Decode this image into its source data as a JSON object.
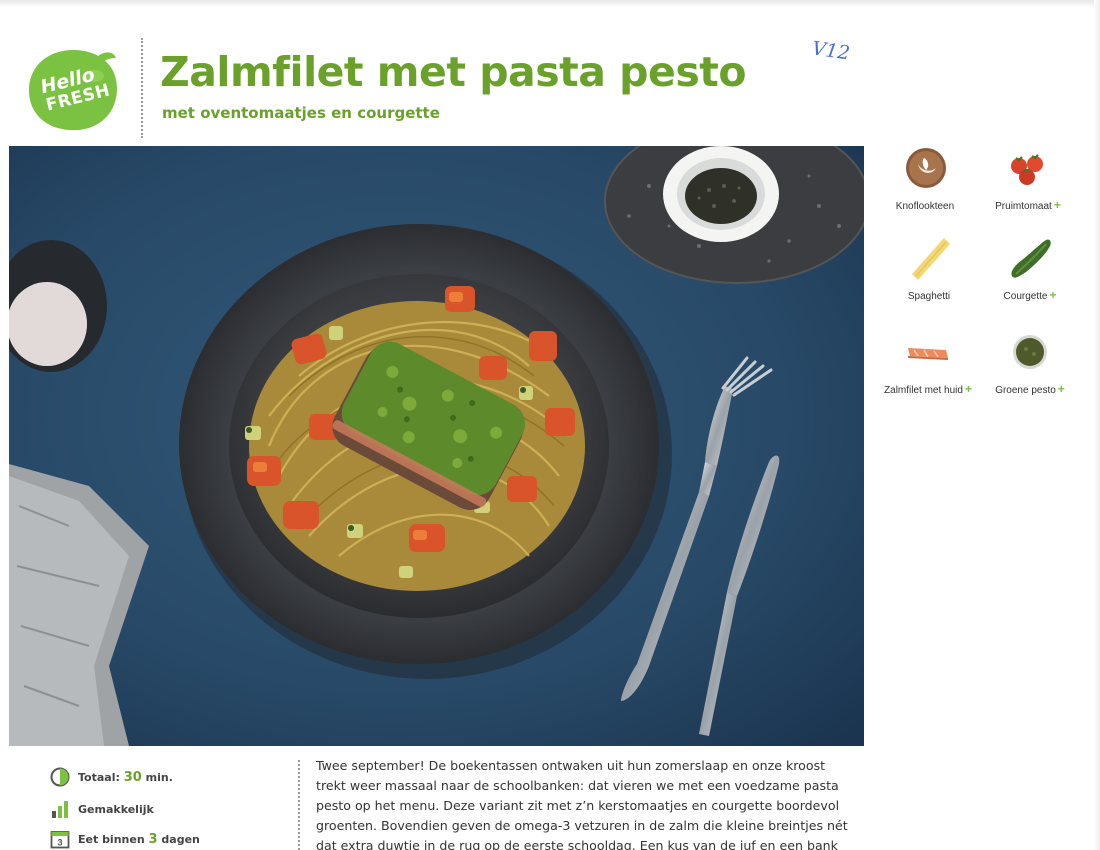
{
  "header": {
    "logo_line1": "Hello",
    "logo_line2": "FRESH",
    "title": "Zalmfilet met pasta pesto",
    "subtitle": "met oventomaatjes en courgette",
    "handwritten_note": "V12"
  },
  "ingredients": [
    {
      "name": "Knoflookteen",
      "plus": ""
    },
    {
      "name": "Pruimtomaat",
      "plus": "+"
    },
    {
      "name": "Spaghetti",
      "plus": ""
    },
    {
      "name": "Courgette",
      "plus": "+"
    },
    {
      "name": "Zalmfilet met huid",
      "plus": "+"
    },
    {
      "name": "Groene pesto",
      "plus": "+"
    }
  ],
  "meta": {
    "total_label": "Totaal:",
    "total_value": "30",
    "total_unit": "min.",
    "difficulty": "Gemakkelijk",
    "eat_within_prefix": "Eet binnen",
    "eat_within_value": "3",
    "eat_within_suffix": "dagen",
    "calendar_number": "3"
  },
  "intro_text": "Twee september! De boekentassen ontwaken uit hun zomerslaap en onze kroost trekt weer massaal naar de schoolbanken: dat vieren we met een voedzame pasta pesto op het menu. Deze variant zit met z’n kerstomaatjes en courgette boordevol groenten. Bovendien geven de omega-3 vetzuren in de zalm die kleine breintjes nét dat extra duwtje in de rug op de eerste schooldag. Een kus van de juf en een bank vooruit, smakelijk!",
  "colors": {
    "brand_green": "#6aa12b",
    "plus_green": "#7cc242",
    "tabletop_blue": "#2a4a66",
    "handwriting_blue": "#4a6fd1"
  }
}
